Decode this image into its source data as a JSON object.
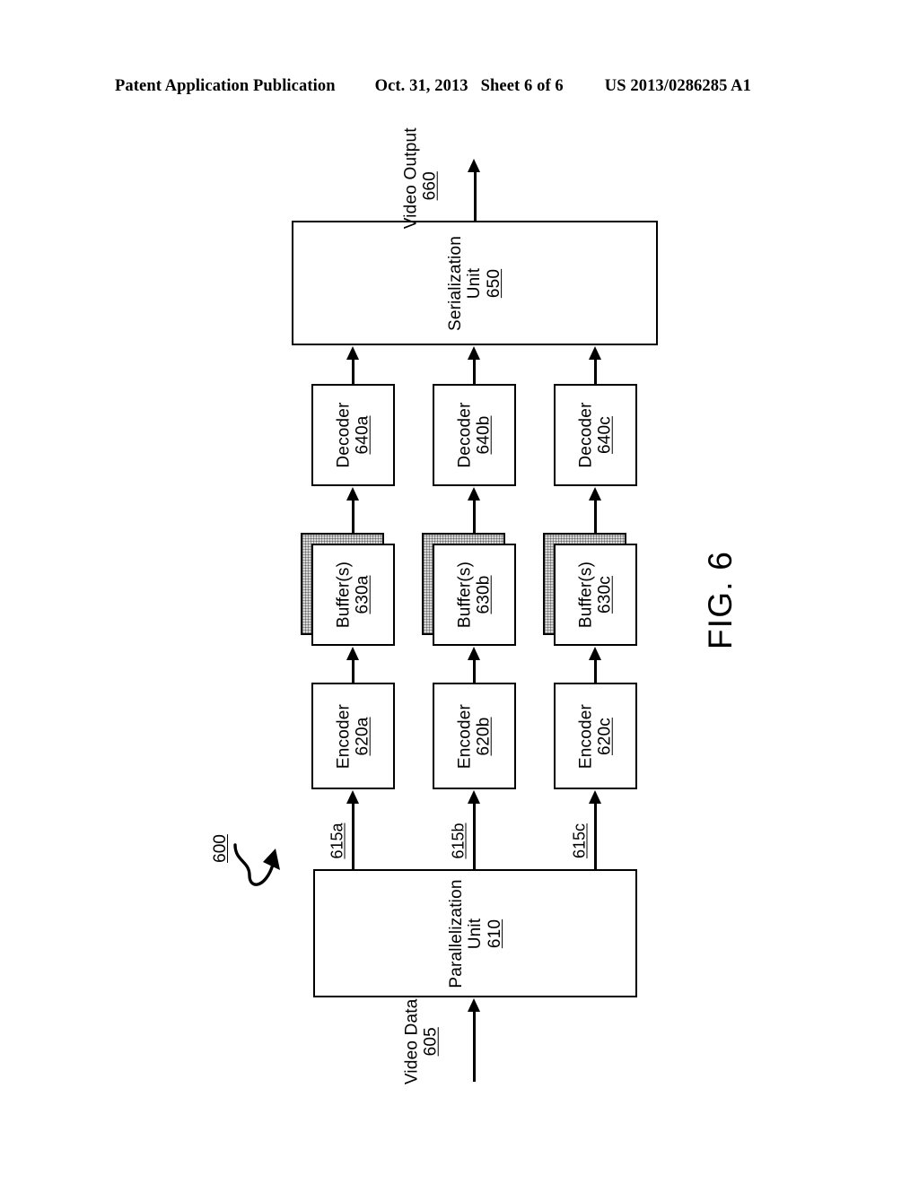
{
  "header": {
    "publication": "Patent Application Publication",
    "date": "Oct. 31, 2013",
    "sheet": "Sheet 6 of 6",
    "patent_number": "US 2013/0286285 A1"
  },
  "figure": {
    "caption": "FIG. 6",
    "system_ref": "600",
    "input": {
      "label": "Video Data",
      "ref": "605"
    },
    "output": {
      "label": "Video Output",
      "ref": "660"
    },
    "parallelization_unit": {
      "label_line1": "Parallelization",
      "label_line2": "Unit",
      "ref": "610"
    },
    "serialization_unit": {
      "label_line1": "Serialization",
      "label_line2": "Unit",
      "ref": "650"
    },
    "channel_refs": [
      "615a",
      "615b",
      "615c"
    ],
    "encoders": [
      {
        "label": "Encoder",
        "ref": "620a"
      },
      {
        "label": "Encoder",
        "ref": "620b"
      },
      {
        "label": "Encoder",
        "ref": "620c"
      }
    ],
    "buffers": [
      {
        "label": "Buffer(s)",
        "ref": "630a"
      },
      {
        "label": "Buffer(s)",
        "ref": "630b"
      },
      {
        "label": "Buffer(s)",
        "ref": "630c"
      }
    ],
    "decoders": [
      {
        "label": "Decoder",
        "ref": "640a"
      },
      {
        "label": "Decoder",
        "ref": "640b"
      },
      {
        "label": "Decoder",
        "ref": "640c"
      }
    ]
  },
  "colors": {
    "ink": "#000000",
    "paper": "#ffffff",
    "buffer_stack_fill": "#d9d9d9"
  }
}
